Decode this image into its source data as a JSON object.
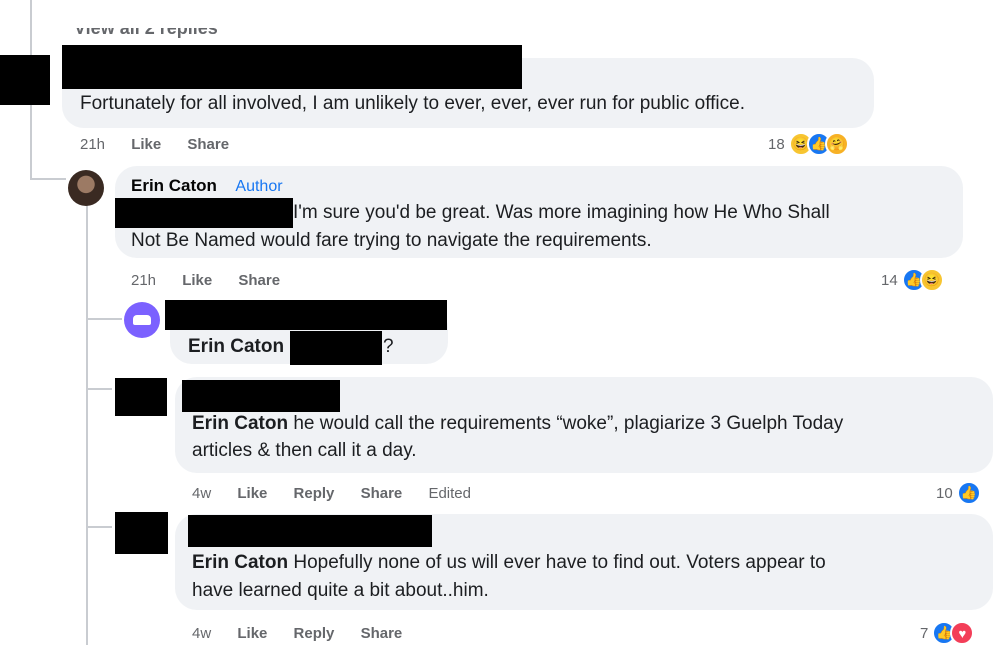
{
  "view_replies": "View all 2 replies",
  "comments": [
    {
      "text": "Fortunately for all involved, I am unlikely to ever, ever, ever run for public office.",
      "time": "21h",
      "like": "Like",
      "share": "Share",
      "reaction_count": "18",
      "reactions": [
        "haha",
        "like",
        "care"
      ]
    },
    {
      "author": "Erin Caton",
      "badge": "Author",
      "text_line1": "I'm sure you'd be great. Was more imagining how He Who Shall",
      "text_line2": "Not Be Named would fare trying to navigate the requirements.",
      "time": "21h",
      "like": "Like",
      "share": "Share",
      "reaction_count": "14",
      "reactions": [
        "like",
        "haha"
      ]
    },
    {
      "mention": "Erin Caton",
      "text": "?"
    },
    {
      "mention": "Erin Caton",
      "text_line1": "he would call the requirements “woke”, plagiarize 3 Guelph Today",
      "text_line2": "articles & then call it a day.",
      "time": "4w",
      "like": "Like",
      "reply": "Reply",
      "share": "Share",
      "edited": "Edited",
      "reaction_count": "10",
      "reactions": [
        "like"
      ]
    },
    {
      "mention": "Erin Caton",
      "text_line1": "Hopefully none of us will ever have to find out. Voters appear to",
      "text_line2": "have learned quite a bit about..him.",
      "time": "4w",
      "like": "Like",
      "reply": "Reply",
      "share": "Share",
      "reaction_count": "7",
      "reactions": [
        "like",
        "love"
      ]
    }
  ],
  "icons": {
    "like": "thumbs-up-icon",
    "haha": "laugh-emoji-icon",
    "care": "care-emoji-icon",
    "love": "heart-icon"
  },
  "colors": {
    "bubble": "#f0f2f5",
    "accent": "#1877f2",
    "meta": "#65676b",
    "redaction": "#000000"
  }
}
